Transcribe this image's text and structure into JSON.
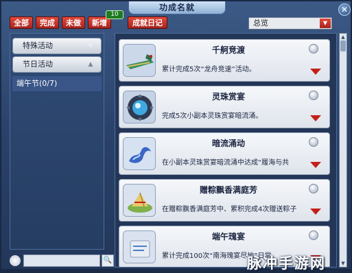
{
  "window": {
    "title": "功成名就"
  },
  "filters": {
    "all": "全部",
    "done": "完成",
    "undone": "未做",
    "new": "新增",
    "new_count": "10",
    "log": "成就日记"
  },
  "dropdown": {
    "selected": "总览"
  },
  "sidebar": {
    "categories": [
      {
        "label": "特殊活动"
      },
      {
        "label": "节日活动"
      }
    ],
    "selected_sub": "端午节(0/7)"
  },
  "achievements": [
    {
      "title": "千舸竞渡",
      "desc": "累计完成5次“龙舟竞速”活动。",
      "icon": "dragon-boat-icon"
    },
    {
      "title": "灵珠赏宴",
      "desc": "完成5次小副本灵珠赏宴暗流涌。",
      "icon": "spirit-pearl-icon"
    },
    {
      "title": "暗流涌动",
      "desc": "在小副本灵珠赏宴暗流涌中达成“履海与共",
      "icon": "wave-icon"
    },
    {
      "title": "赠粽飘香满庭芳",
      "desc": "在赠粽飘香满庭芳中、累积完成4次赠送粽子",
      "icon": "zongzi-icon"
    },
    {
      "title": "端午瑰宴",
      "desc": "累计完成100次“南海瑰宴尽地”日常",
      "icon": "feast-icon"
    }
  ],
  "search": {
    "placeholder": ""
  },
  "watermark": "脉冲手游网",
  "colors": {
    "accent_red": "#c3201a",
    "badge_green": "#1f7a22",
    "frame_blue": "#2a4169"
  }
}
